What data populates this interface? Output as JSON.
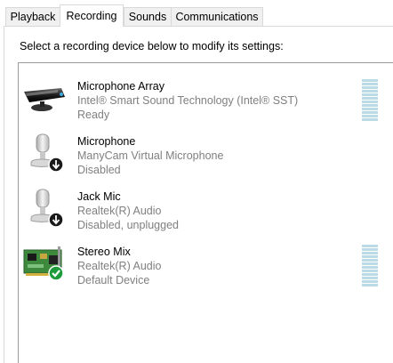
{
  "tabs": [
    {
      "label": "Playback"
    },
    {
      "label": "Recording"
    },
    {
      "label": "Sounds"
    },
    {
      "label": "Communications"
    }
  ],
  "instruction": "Select a recording device below to modify its settings:",
  "devices": [
    {
      "name": "Microphone Array",
      "driver": "Intel® Smart Sound Technology (Intel® SST)",
      "status": "Ready",
      "icon": "microphone-array-icon",
      "meter": true
    },
    {
      "name": "Microphone",
      "driver": "ManyCam Virtual Microphone",
      "status": "Disabled",
      "icon": "microphone-disabled-icon",
      "meter": false
    },
    {
      "name": "Jack Mic",
      "driver": "Realtek(R) Audio",
      "status": "Disabled, unplugged",
      "icon": "microphone-disabled-icon",
      "meter": false
    },
    {
      "name": "Stereo Mix",
      "driver": "Realtek(R) Audio",
      "status": "Default Device",
      "icon": "sound-card-default-icon",
      "meter": true
    }
  ],
  "colors": {
    "meter": "#bcdbe6",
    "default_badge": "#1e9c3c",
    "disabled_badge": "#1a1a1a"
  }
}
